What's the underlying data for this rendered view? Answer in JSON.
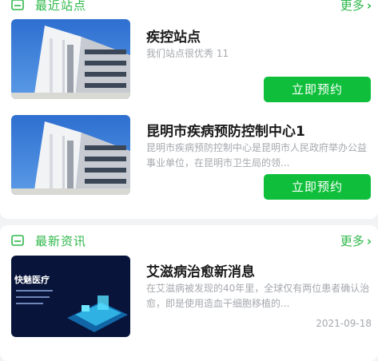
{
  "recent_sites": {
    "title": "最近站点",
    "more_label": "更多",
    "items": [
      {
        "title": "疾控站点",
        "desc": "我们站点很优秀 11",
        "button": "立即预约"
      },
      {
        "title": "昆明市疾病预防控制中心1",
        "desc": "昆明市疾病预防控制中心是昆明市人民政府举办公益事业单位，在昆明市卫生局的领...",
        "button": "立即预约"
      }
    ]
  },
  "latest_news": {
    "title": "最新资讯",
    "more_label": "更多",
    "items": [
      {
        "title": "艾滋病治愈新消息",
        "desc": "在艾滋病被发现的40年里，全球仅有两位患者确认治愈，即是使用造血干细胞移植的...",
        "date": "2021-09-18",
        "thumb_caption": "快魅医疗"
      }
    ]
  },
  "colors": {
    "accent": "#2fb84a",
    "button": "#0fbf3b"
  },
  "icons": {
    "section": "list-card-icon",
    "more": "chevron-right-icon"
  }
}
